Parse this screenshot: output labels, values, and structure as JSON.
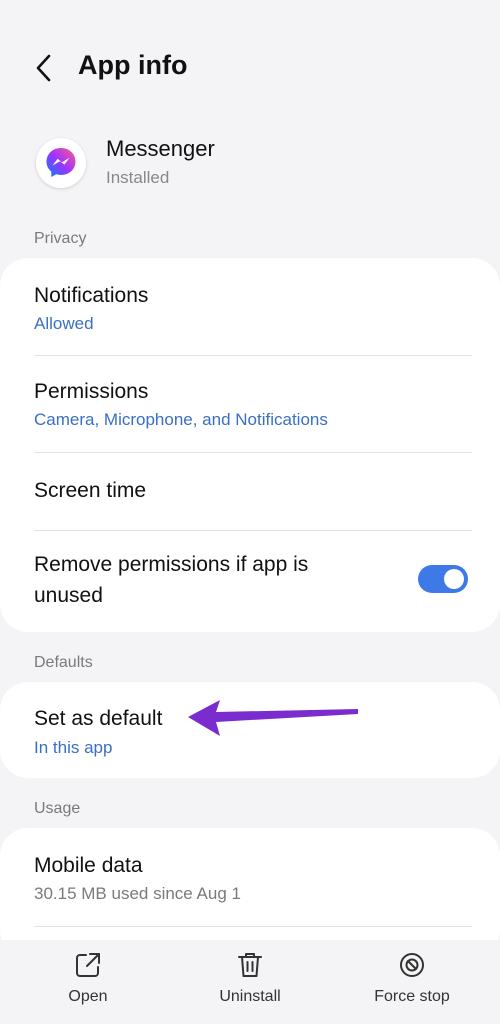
{
  "header": {
    "title": "App info",
    "back_icon": "chevron-left-icon"
  },
  "app": {
    "name": "Messenger",
    "status": "Installed",
    "icon": "messenger-icon"
  },
  "sections": {
    "privacy": "Privacy",
    "defaults": "Defaults",
    "usage": "Usage"
  },
  "privacy_items": {
    "notifications": {
      "title": "Notifications",
      "sub": "Allowed"
    },
    "permissions": {
      "title": "Permissions",
      "sub": "Camera, Microphone, and Notifications"
    },
    "screen_time": {
      "title": "Screen time"
    },
    "remove_permissions": {
      "title_line1": "Remove permissions if app is",
      "title_line2": "unused",
      "toggle_on": true
    }
  },
  "defaults_items": {
    "set_default": {
      "title": "Set as default",
      "sub": "In this app"
    }
  },
  "usage_items": {
    "mobile_data": {
      "title": "Mobile data",
      "sub": "30.15 MB used since Aug 1"
    }
  },
  "bottom_bar": {
    "open": "Open",
    "uninstall": "Uninstall",
    "force_stop": "Force stop"
  },
  "colors": {
    "accent_blue": "#3a6fc4",
    "toggle_blue": "#3e79e8",
    "annotation_arrow": "#7b2ccf"
  }
}
